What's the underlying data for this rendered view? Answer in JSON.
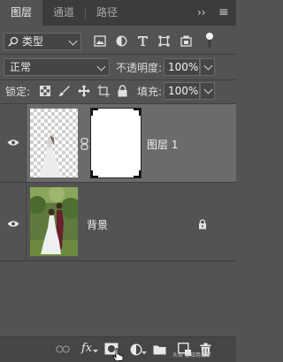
{
  "tabs": [
    {
      "label": "图层",
      "active": true
    },
    {
      "label": "通道",
      "active": false
    },
    {
      "label": "路径",
      "active": false
    }
  ],
  "panel_menu": {
    "collapse_label": "››",
    "menu_label": "≡"
  },
  "filter": {
    "kind_label": "类型",
    "icons": [
      "pixel-layer-filter-icon",
      "adjustment-filter-icon",
      "type-filter-icon",
      "shape-filter-icon",
      "smart-object-filter-icon",
      "filter-toggle-icon"
    ]
  },
  "blend": {
    "mode": "正常",
    "opacity_label": "不透明度:",
    "opacity_value": "100%"
  },
  "lock": {
    "label": "锁定:",
    "fill_label": "填充:",
    "fill_value": "100%",
    "icons": [
      "lock-transparent-icon",
      "lock-image-icon",
      "lock-position-icon",
      "lock-artboard-icon",
      "lock-all-icon"
    ]
  },
  "layers": [
    {
      "name": "图层 1",
      "visible": true,
      "selected": true,
      "has_mask": true,
      "locked": false
    },
    {
      "name": "背景",
      "visible": true,
      "selected": false,
      "has_mask": false,
      "locked": true
    }
  ],
  "bottom_icons": [
    "link-layers-icon",
    "fx-icon",
    "add-mask-icon",
    "adjustment-layer-icon",
    "new-group-icon",
    "new-layer-icon",
    "delete-layer-icon"
  ],
  "fx_label": "fx",
  "watermark": "头条 @知用我学"
}
